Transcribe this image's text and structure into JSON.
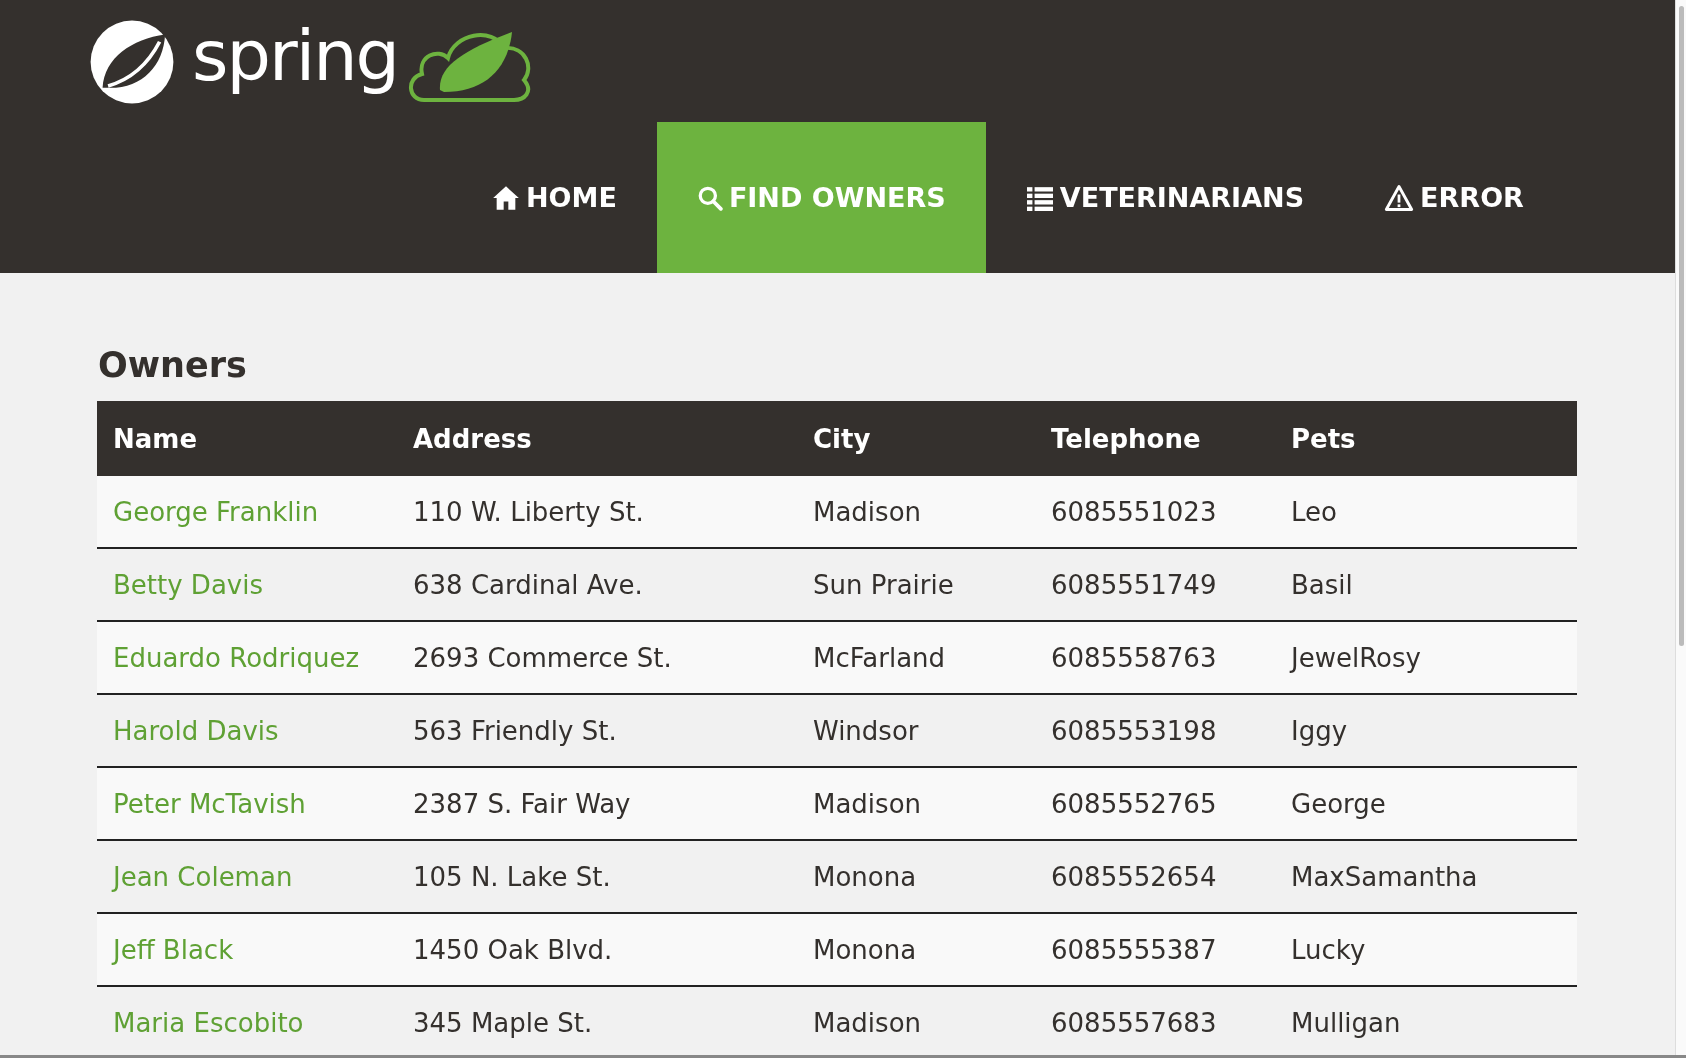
{
  "logo": {
    "text": "spring"
  },
  "nav": [
    {
      "label": "HOME",
      "selected": false
    },
    {
      "label": "FIND OWNERS",
      "selected": true
    },
    {
      "label": "VETERINARIANS",
      "selected": false
    },
    {
      "label": "ERROR",
      "selected": false
    }
  ],
  "heading": "Owners",
  "table": {
    "columns": [
      "Name",
      "Address",
      "City",
      "Telephone",
      "Pets"
    ],
    "rows": [
      [
        "George Franklin",
        "110 W. Liberty St.",
        "Madison",
        "6085551023",
        "Leo"
      ],
      [
        "Betty Davis",
        "638 Cardinal Ave.",
        "Sun Prairie",
        "6085551749",
        "Basil"
      ],
      [
        "Eduardo Rodriquez",
        "2693 Commerce St.",
        "McFarland",
        "6085558763",
        "JewelRosy"
      ],
      [
        "Harold Davis",
        "563 Friendly St.",
        "Windsor",
        "6085553198",
        "Iggy"
      ],
      [
        "Peter McTavish",
        "2387 S. Fair Way",
        "Madison",
        "6085552765",
        "George"
      ],
      [
        "Jean Coleman",
        "105 N. Lake St.",
        "Monona",
        "6085552654",
        "MaxSamantha"
      ],
      [
        "Jeff Black",
        "1450 Oak Blvd.",
        "Monona",
        "6085555387",
        "Lucky"
      ],
      [
        "Maria Escobito",
        "345 Maple St.",
        "Madison",
        "6085557683",
        "Mulligan"
      ]
    ]
  }
}
